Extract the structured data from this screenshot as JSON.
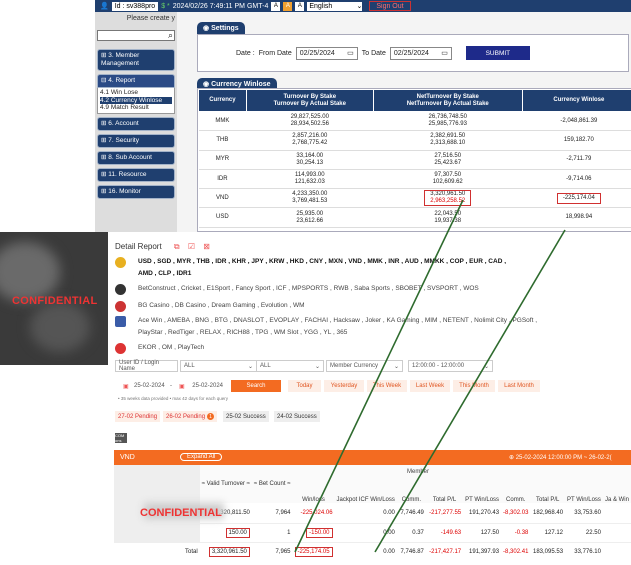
{
  "topbar": {
    "user": "Id : sv388pro",
    "balance": "$ *",
    "datetime": "2024/02/26 7:49:11 PM GMT-4",
    "badges": [
      "A",
      "A",
      "A"
    ],
    "language": "English",
    "signout": "Sign Out"
  },
  "sidebar": {
    "please_create": "Please create y",
    "menu": [
      "3. Member Management",
      "4. Report",
      "6. Account",
      "7. Security",
      "8. Sub Account",
      "11. Resource",
      "16. Monitor"
    ],
    "report_sub": [
      "4.1 Win Lose",
      "4.2 Currency Winlose",
      "4.9 Match Result"
    ]
  },
  "settings": {
    "title": "Settings",
    "date_label": "Date :",
    "from_label": "From Date",
    "from_value": "02/25/2024",
    "to_label": "To Date",
    "to_value": "02/25/2024",
    "submit": "SUBMIT"
  },
  "winlose": {
    "title": "Currency Winlose",
    "headers": [
      "Currency",
      "Turnover By Stake\nTurnover By Actual Stake",
      "NetTurnover By Stake\nNetTurnover By Actual Stake",
      "Currency Winlose"
    ],
    "rows": [
      {
        "cur": "MMK",
        "t1": "29,827,525.00",
        "t2": "28,934,502.56",
        "n1": "26,736,748.50",
        "n2": "25,985,776.93",
        "wl": "-2,048,861.39"
      },
      {
        "cur": "THB",
        "t1": "2,857,216.00",
        "t2": "2,768,775.42",
        "n1": "2,382,691.50",
        "n2": "2,313,688.10",
        "wl": "159,182.70"
      },
      {
        "cur": "MYR",
        "t1": "33,164.00",
        "t2": "30,254.13",
        "n1": "27,516.50",
        "n2": "25,423.67",
        "wl": "-2,711.79"
      },
      {
        "cur": "IDR",
        "t1": "114,993.00",
        "t2": "121,632.03",
        "n1": "97,307.50",
        "n2": "102,609.62",
        "wl": "-9,714.06"
      },
      {
        "cur": "VND",
        "t1": "4,233,350.00",
        "t2": "3,769,481.53",
        "n1": "3,320,961.50",
        "n2": "2,963,258.52",
        "wl": "-225,174.04"
      },
      {
        "cur": "USD",
        "t1": "25,935.00",
        "t2": "23,612.66",
        "n1": "22,043.50",
        "n2": "19,937.38",
        "wl": "18,998.94"
      }
    ]
  },
  "confidential": "CONFIDENTIAL",
  "detail": {
    "title": "Detail Report",
    "currencies": "USD ,  SGD ,  MYR ,  THB ,  IDR ,  KHR ,  JPY ,  KRW ,  HKD ,  CNY ,  MXN ,  VND ,  MMK ,  INR ,  AUD ,  MMKK ,  COP ,  EUR ,  CAD ,",
    "currencies2": "AMD ,  CLP ,  IDR1",
    "sports": "BetConstruct ,  Cricket ,  E1Sport ,  Fancy Sport ,  ICF ,  MPSPORTS ,  RWB ,  Saba Sports ,  SBOBET ,  SVSPORT ,  WOS",
    "casino": "BG Casino ,  DB Casino ,  Dream Gaming ,  Evolution ,  WM",
    "games": "Ace Win ,  AMEBA ,  BNG ,  BTG ,  DNASLOT ,  EVOPLAY ,  FACHAI ,  Hacksaw ,  Joker ,  KA Gaming ,  MIM ,  NETENT ,  Nolimit City ,  PGSoft ,",
    "games2": "PlayStar ,  RedTiger ,  RELAX ,  RICH88 ,  TPG ,  WM Slot ,  YGG ,  YL ,  365",
    "other": "EKOR ,  OM ,  PlayTech",
    "filters": {
      "user_placeholder": "User ID / Login Name",
      "all1": "ALL",
      "all2": "ALL",
      "member_currency": "Member Currency",
      "time": "12:00:00 - 12:00:00"
    },
    "dates": {
      "from": "25-02-2024",
      "to": "25-02-2024"
    },
    "buttons": [
      "Search",
      "Today",
      "Yesterday",
      "This Week",
      "Last Week",
      "This Month",
      "Last Month"
    ],
    "note": "• 35 weeks data provided • max 42 days for each query",
    "pending": [
      "27-02 Pending",
      "26-02 Pending",
      "25-02 Success",
      "24-02 Success"
    ],
    "pending_badge": "1",
    "chip": "COM ons",
    "vnd": {
      "label": "VND",
      "expand": "Expand All",
      "date": "⊕ 25-02-2024 12:00:00 PM ~ 26-02-2("
    },
    "cols": [
      "Valid Turnover",
      "Bet Count",
      "Win/loss",
      "Jackpot ICF Win/Loss",
      "Comm.",
      "Total P/L",
      "PT Win/Loss",
      "Comm.",
      "Total P/L",
      "PT Win/Loss",
      "Ja & Win"
    ],
    "member_label": "Member",
    "rows": [
      [
        "3,320,811.50",
        "7,964",
        "-225,024.06",
        "0.00",
        "7,746.49",
        "-217,277.55",
        "191,270.43",
        "-8,302.03",
        "182,968.40",
        "33,753.60"
      ],
      [
        "150.00",
        "1",
        "-150.00",
        "0.00",
        "0.37",
        "-149.63",
        "127.50",
        "-0.38",
        "127.12",
        "22.50"
      ]
    ],
    "total": [
      "Total",
      "3,320,961.50",
      "7,965",
      "-225,174.05",
      "0.00",
      "7,746.87",
      "-217,427.17",
      "191,397.93",
      "-8,302.41",
      "183,095.53",
      "33,776.10"
    ]
  }
}
